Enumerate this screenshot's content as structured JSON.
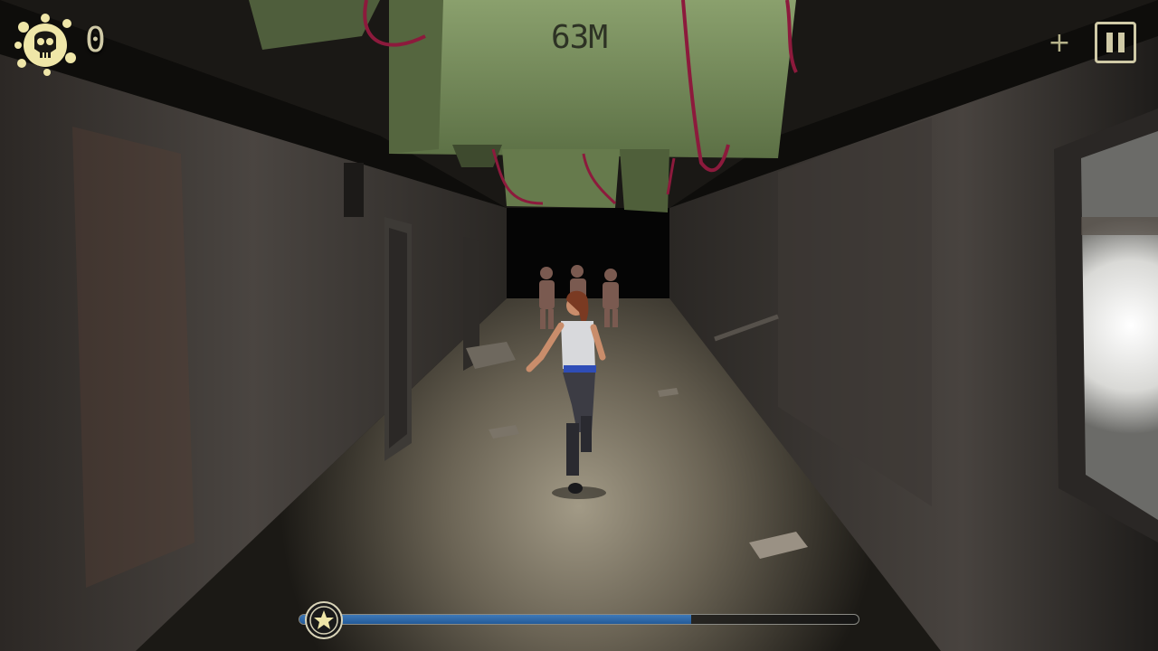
{
  "hud": {
    "kills": "0",
    "distance": "63M",
    "plus_symbol": "+",
    "icons": {
      "kills": "skull-splat-icon",
      "add": "plus-icon",
      "pause": "pause-icon",
      "progress": "star-icon"
    },
    "progress_fraction": 0.7
  },
  "colors": {
    "hud_text": "#cfc9a6",
    "splat": "#efe6a8",
    "progress_fill": "#2f6aa8",
    "signboard": "#748a5a"
  }
}
